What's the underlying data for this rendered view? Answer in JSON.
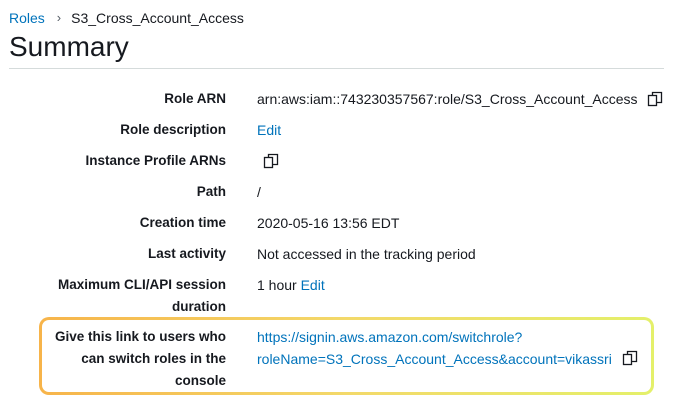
{
  "breadcrumb": {
    "parent": "Roles",
    "separator": "›",
    "current": "S3_Cross_Account_Access"
  },
  "page_title": "Summary",
  "summary": {
    "role_arn": {
      "label": "Role ARN",
      "value": "arn:aws:iam::743230357567:role/S3_Cross_Account_Access",
      "icon": "copy-icon"
    },
    "role_description": {
      "label": "Role description",
      "edit_link": "Edit"
    },
    "instance_profile_arns": {
      "label": "Instance Profile ARNs",
      "icon": "copy-icon"
    },
    "path": {
      "label": "Path",
      "value": "/"
    },
    "creation_time": {
      "label": "Creation time",
      "value": "2020-05-16 13:56 EDT"
    },
    "last_activity": {
      "label": "Last activity",
      "value": "Not accessed in the tracking period"
    },
    "max_session": {
      "label_line1": "Maximum CLI/API session",
      "label_line2": "duration",
      "value": "1 hour",
      "edit_link": "Edit"
    },
    "switch_link": {
      "label_line1": "Give this link to users who",
      "label_line2": "can switch roles in the",
      "label_line3": "console",
      "url_line1": "https://signin.aws.amazon.com/switchrole?",
      "url_line2": "roleName=S3_Cross_Account_Access&account=vikassri",
      "icon": "copy-icon"
    }
  },
  "colors": {
    "link": "#0073bb",
    "highlight_start": "#f7b44a",
    "highlight_end": "#e4f06a"
  }
}
